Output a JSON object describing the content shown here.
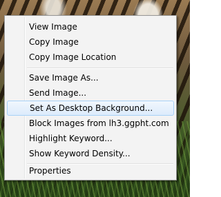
{
  "context_menu": {
    "items": [
      {
        "label": "View Image"
      },
      {
        "label": "Copy Image"
      },
      {
        "label": "Copy Image Location"
      },
      {
        "label": "Save Image As..."
      },
      {
        "label": "Send Image..."
      },
      {
        "label": "Set As Desktop Background..."
      },
      {
        "label": "Block Images from lh3.ggpht.com"
      },
      {
        "label": "Highlight Keyword..."
      },
      {
        "label": "Show Keyword Density..."
      },
      {
        "label": "Properties"
      }
    ],
    "highlighted": "Set As Desktop Background..."
  }
}
